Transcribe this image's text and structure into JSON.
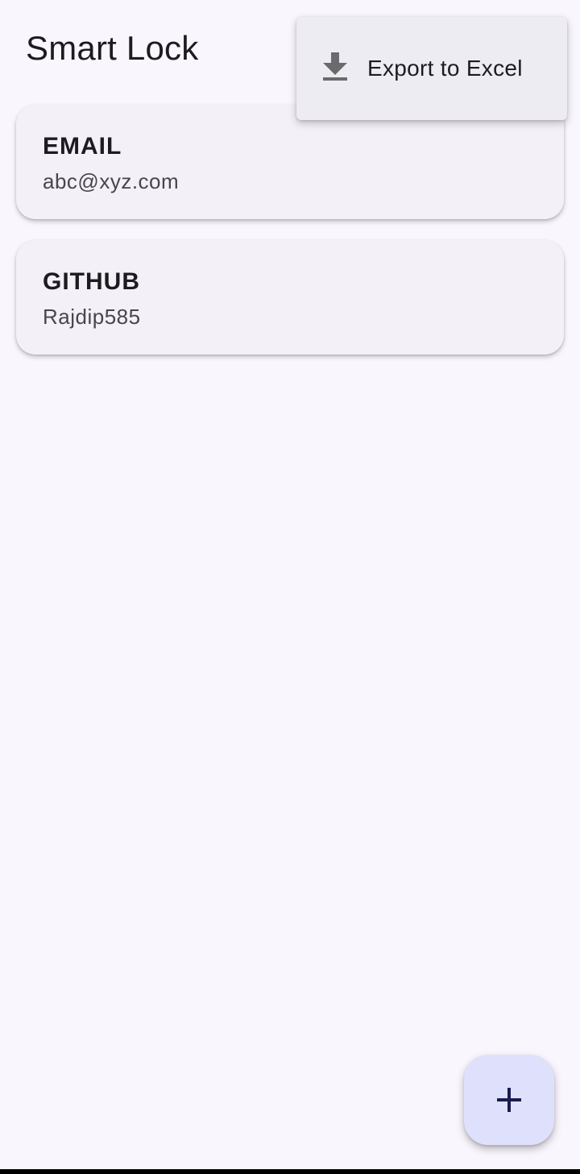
{
  "app_bar": {
    "title": "Smart Lock"
  },
  "entries": [
    {
      "title": "EMAIL",
      "value": "abc@xyz.com"
    },
    {
      "title": "GITHUB",
      "value": "Rajdip585"
    }
  ],
  "overflow_menu": {
    "items": [
      {
        "label": "Export to Excel",
        "icon": "download-icon"
      }
    ]
  },
  "fab": {
    "icon": "add-icon"
  },
  "colors": {
    "background": "#f9f6fd",
    "card": "#f3f0f7",
    "menu": "#edecf2",
    "fab": "#dfe0fc",
    "fab_icon": "#1a1c4e",
    "menu_icon": "#6b6b6e"
  }
}
